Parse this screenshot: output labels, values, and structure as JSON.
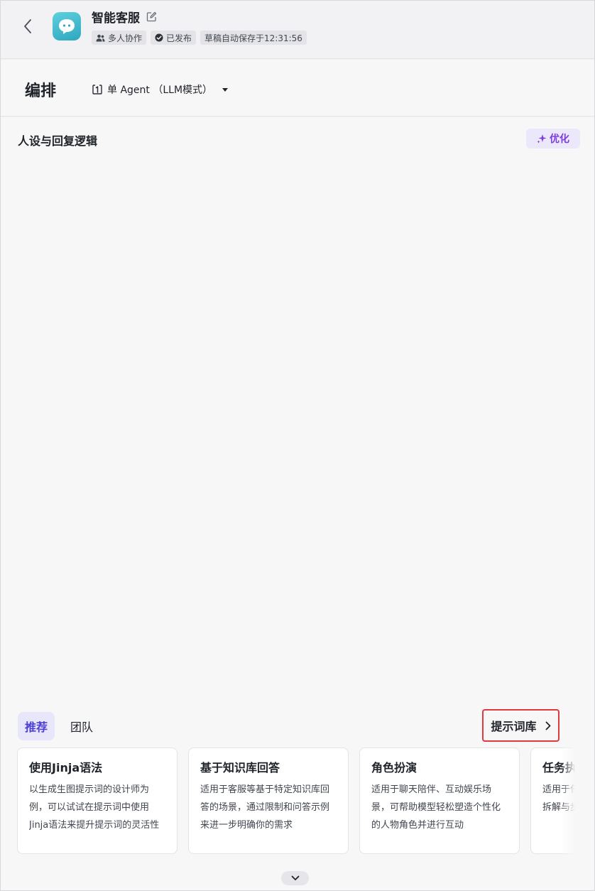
{
  "header": {
    "title": "智能客服",
    "tags": {
      "collab": "多人协作",
      "published": "已发布",
      "autosave": "草稿自动保存于12:31:56"
    }
  },
  "section": {
    "title": "编排",
    "mode_label": "单 Agent （LLM模式）"
  },
  "editor": {
    "title": "人设与回复逻辑",
    "optimize_label": "优化"
  },
  "tabs": {
    "recommend": "推荐",
    "team": "团队"
  },
  "library_link": "提示词库",
  "cards": [
    {
      "title": "使用Jinja语法",
      "desc": "以生成生图提示词的设计师为例，可以试试在提示词中使用Jinja语法来提升提示词的灵活性"
    },
    {
      "title": "基于知识库回答",
      "desc": "适用于客服等基于特定知识库回答的场景，通过限制和问答示例来进一步明确你的需求"
    },
    {
      "title": "角色扮演",
      "desc": "适用于聊天陪伴、互动娱乐场景，可帮助模型轻松塑造个性化的人物角色并进行互动"
    },
    {
      "title": "任务执行",
      "desc": "适用于任务执行场景，通过任务拆解与步骤说明完成任务"
    }
  ],
  "colors": {
    "accent": "#4b3fd6",
    "optimize": "#7e3de0",
    "highlight_border": "#e0393e",
    "avatar": "#3db8cc"
  },
  "icons": {
    "back": "chevron-left-icon",
    "edit": "edit-icon",
    "collab": "users-icon",
    "published": "check-circle-icon",
    "mode": "agent-mode-icon",
    "optimize": "sparkle-icon",
    "library": "chevron-right-icon",
    "collapse": "chevron-down-icon"
  }
}
